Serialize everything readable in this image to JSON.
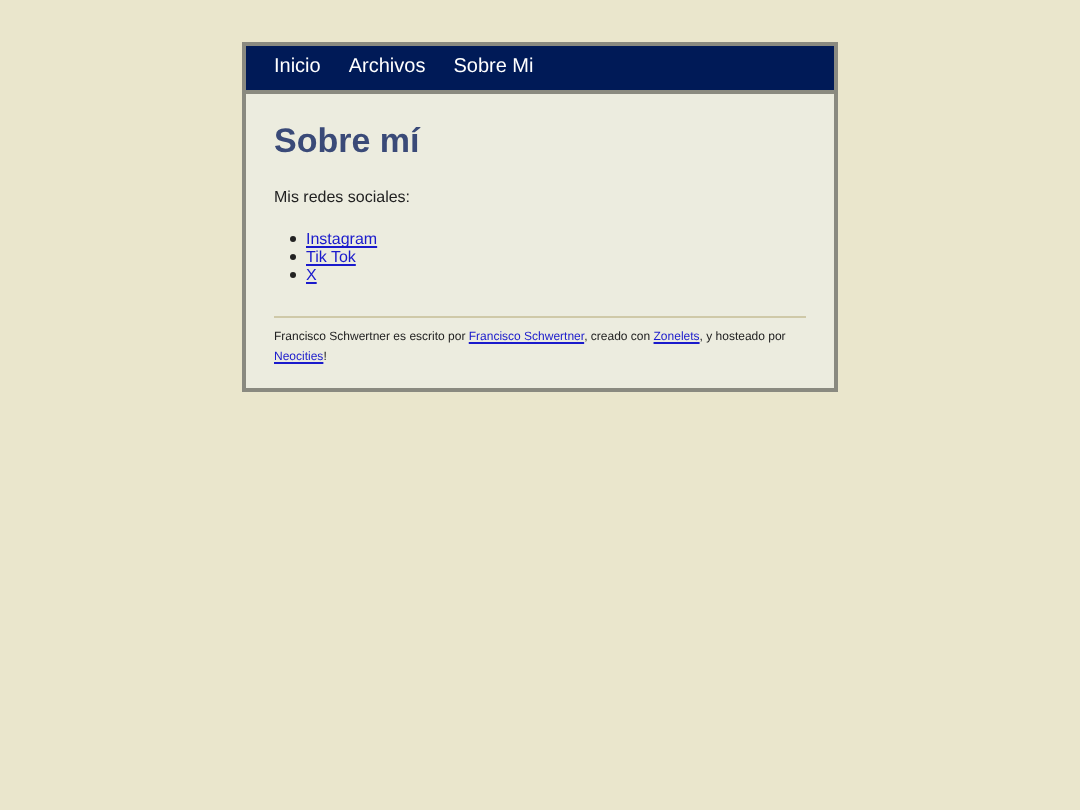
{
  "nav": [
    "Inicio",
    "Archivos",
    "Sobre Mi"
  ],
  "heading": "Sobre mí",
  "intro": "Mis redes sociales:",
  "links": [
    "Instagram",
    "Tik Tok",
    "X"
  ],
  "footer": [
    {
      "kind": "text",
      "text": "Francisco Schwertner es escrito por "
    },
    {
      "kind": "link",
      "text": "Francisco Schwertner"
    },
    {
      "kind": "text",
      "text": ", creado con "
    },
    {
      "kind": "link",
      "text": "Zonelets"
    },
    {
      "kind": "text",
      "text": ", y hosteado por "
    },
    {
      "kind": "link",
      "text": "Neocities"
    },
    {
      "kind": "text",
      "text": "!"
    }
  ]
}
